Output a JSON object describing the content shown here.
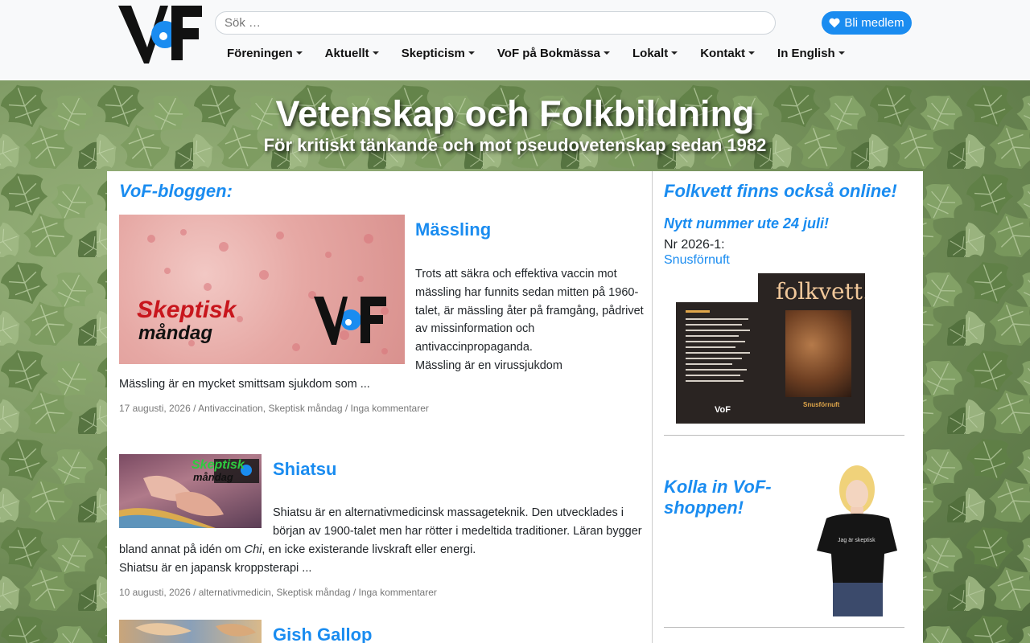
{
  "header": {
    "search_placeholder": "Sök …",
    "member_button": "Bli medlem",
    "nav": [
      {
        "label": "Föreningen"
      },
      {
        "label": "Aktuellt"
      },
      {
        "label": "Skepticism"
      },
      {
        "label": "VoF på Bokmässa"
      },
      {
        "label": "Lokalt"
      },
      {
        "label": "Kontakt"
      },
      {
        "label": "In English"
      }
    ],
    "logo_text": "VoF"
  },
  "hero": {
    "title": "Vetenskap och Folkbildning",
    "subtitle": "För kritiskt tänkande och mot pseudovetenskap sedan 1982"
  },
  "blog": {
    "heading": "VoF-bloggen:",
    "posts": [
      {
        "title": "Mässling",
        "paragraphs": [
          "Trots att säkra och effektiva vaccin mot",
          "mässling har funnits sedan mitten på 1960-",
          "talet, är mässling åter på framgång, pådrivet",
          "av missinformation och",
          "antivaccinpropaganda.",
          "Mässling är en virussjukdom",
          "Mässling är en mycket smittsam sjukdom som ..."
        ],
        "meta": "17 augusti, 2026 / Antivaccination, Skeptisk måndag / Inga kommentarer",
        "image_badge": {
          "skeptisk": "Skeptisk",
          "mandag": "måndag"
        }
      },
      {
        "title": "Shiatsu",
        "paragraphs": [
          "Shiatsu är en alternativmedicinsk massageteknik. Den utvecklades i",
          "början av 1900-talet men har rötter i medeltida traditioner. Läran bygger",
          "bland annat på idén om ",
          "Chi",
          ", en icke existerande livskraft eller energi.",
          "Shiatsu är en japansk kroppsterapi ..."
        ],
        "meta": "10 augusti, 2026 / alternativmedicin, Skeptisk måndag / Inga kommentarer",
        "image_badge": {
          "skeptisk": "Skeptisk",
          "mandag": "måndag"
        }
      },
      {
        "title": "Gish Gallop"
      }
    ]
  },
  "sidebar": {
    "heading": "Folkvett finns också online!",
    "news": "Nytt nummer ute 24 juli!",
    "issue": "Nr 2026-1:",
    "issue_link": "Snusförnuft",
    "cover": {
      "title": "folkvett.",
      "theme": "Snusförnuft",
      "brand": "VoF"
    },
    "shop_heading": "Kolla in VoF-shoppen!",
    "shirt_text": "Jag är skeptisk"
  },
  "colors": {
    "accent": "#1a8cf0",
    "header_bg": "#f8f9fa",
    "red": "#c8161d"
  }
}
